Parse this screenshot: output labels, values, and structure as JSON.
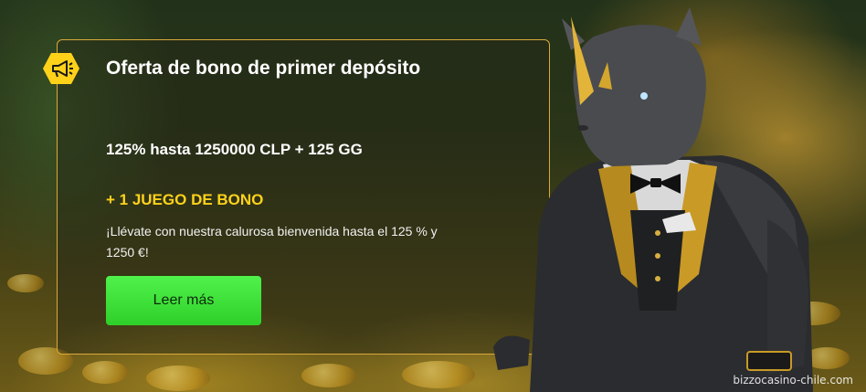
{
  "banner": {
    "title": "Oferta de bono de primer depósito",
    "offer": "125% hasta 1250000 CLP + 125 GG",
    "extra": "+ 1 JUEGO DE BONO",
    "description": "¡Llévate con nuestra calurosa bienvenida hasta el 125 % y 1250 €!",
    "button_label": "Leer más"
  },
  "badge": {
    "icon": "megaphone-icon"
  },
  "mascot": {
    "icon": "rhino-tuxedo-illustration"
  },
  "watermark": "bizzocasino-chile.com",
  "colors": {
    "accent_gold": "#ffd21a",
    "border_gold": "#d9a93a",
    "cta_green": "#3ae034"
  }
}
